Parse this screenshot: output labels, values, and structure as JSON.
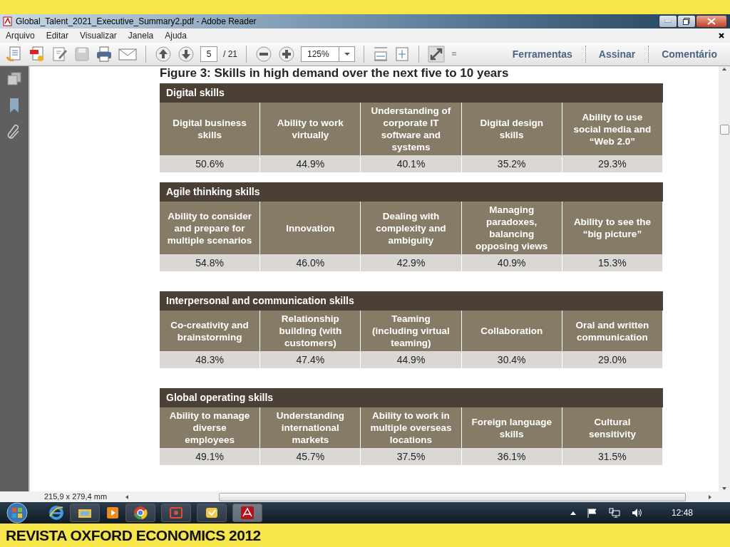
{
  "window": {
    "title": "Global_Talent_2021_Executive_Summary2.pdf - Adobe Reader"
  },
  "menu": [
    "Arquivo",
    "Editar",
    "Visualizar",
    "Janela",
    "Ajuda"
  ],
  "toolbar": {
    "page": "5",
    "page_total": "/ 21",
    "zoom": "125%",
    "links": [
      "Ferramentas",
      "Assinar",
      "Comentário"
    ]
  },
  "figure": {
    "title": "Figure 3: Skills in high demand over the next five to 10 years",
    "sections": [
      {
        "name": "Digital skills",
        "items": [
          {
            "label": "Digital business skills",
            "value": "50.6%"
          },
          {
            "label": "Ability to work virtually",
            "value": "44.9%"
          },
          {
            "label": "Understanding of corporate IT software and systems",
            "value": "40.1%"
          },
          {
            "label": "Digital design skills",
            "value": "35.2%"
          },
          {
            "label": "Ability to use social media and “Web 2.0”",
            "value": "29.3%"
          }
        ]
      },
      {
        "name": "Agile thinking skills",
        "items": [
          {
            "label": "Ability to consider and prepare for multiple scenarios",
            "value": "54.8%"
          },
          {
            "label": "Innovation",
            "value": "46.0%"
          },
          {
            "label": "Dealing with complexity and ambiguity",
            "value": "42.9%"
          },
          {
            "label": "Managing paradoxes, balancing opposing views",
            "value": "40.9%"
          },
          {
            "label": "Ability to see the “big picture”",
            "value": "15.3%"
          }
        ]
      },
      {
        "name": "Interpersonal and communication skills",
        "items": [
          {
            "label": "Co-creativity and brainstorming",
            "value": "48.3%"
          },
          {
            "label": "Relationship building (with customers)",
            "value": "47.4%"
          },
          {
            "label": "Teaming (including virtual teaming)",
            "value": "44.9%"
          },
          {
            "label": "Collaboration",
            "value": "30.4%"
          },
          {
            "label": "Oral and written communication",
            "value": "29.0%"
          }
        ]
      },
      {
        "name": "Global operating skills",
        "items": [
          {
            "label": "Ability to manage diverse employees",
            "value": "49.1%"
          },
          {
            "label": "Understanding international markets",
            "value": "45.7%"
          },
          {
            "label": "Ability to work in multiple overseas locations",
            "value": "37.5%"
          },
          {
            "label": "Foreign language skills",
            "value": "36.1%"
          },
          {
            "label": "Cultural sensitivity",
            "value": "31.5%"
          }
        ]
      }
    ]
  },
  "page_size": "215,9 x 279,4 mm",
  "taskbar": {
    "clock": "12:48"
  },
  "caption": "REVISTA OXFORD ECONOMICS 2012"
}
